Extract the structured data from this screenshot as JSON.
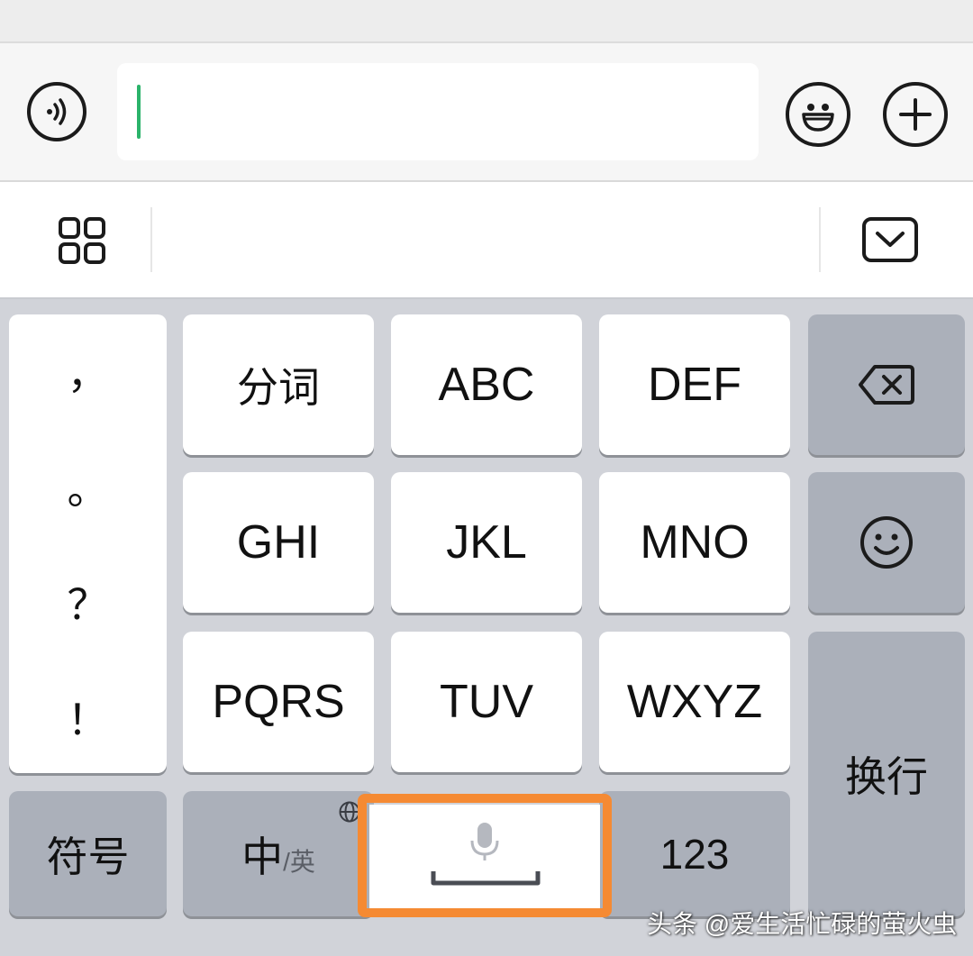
{
  "chat_input": {
    "voice_icon": "voice-wave-icon",
    "text_value": "",
    "emoji_icon": "grin-face-icon",
    "plus_icon": "plus-icon"
  },
  "candidate_bar": {
    "grid_icon": "four-grid-icon",
    "collapse_icon": "keyboard-collapse-icon"
  },
  "keyboard": {
    "punctuation": [
      "，",
      "。",
      "？",
      "！"
    ],
    "rows": [
      [
        "分词",
        "ABC",
        "DEF"
      ],
      [
        "GHI",
        "JKL",
        "MNO"
      ],
      [
        "PQRS",
        "TUV",
        "WXYZ"
      ]
    ],
    "delete_icon": "backspace-icon",
    "emoji_key_icon": "smiley-icon",
    "return_label": "换行",
    "symbols_label": "符号",
    "lang_main": "中",
    "lang_alt": "/英",
    "lang_icon": "globe-icon",
    "space_icon": "microphone-icon",
    "numbers_label": "123"
  },
  "annotation": {
    "highlight_color": "#f58a33"
  },
  "watermark": "头条 @爱生活忙碌的萤火虫"
}
